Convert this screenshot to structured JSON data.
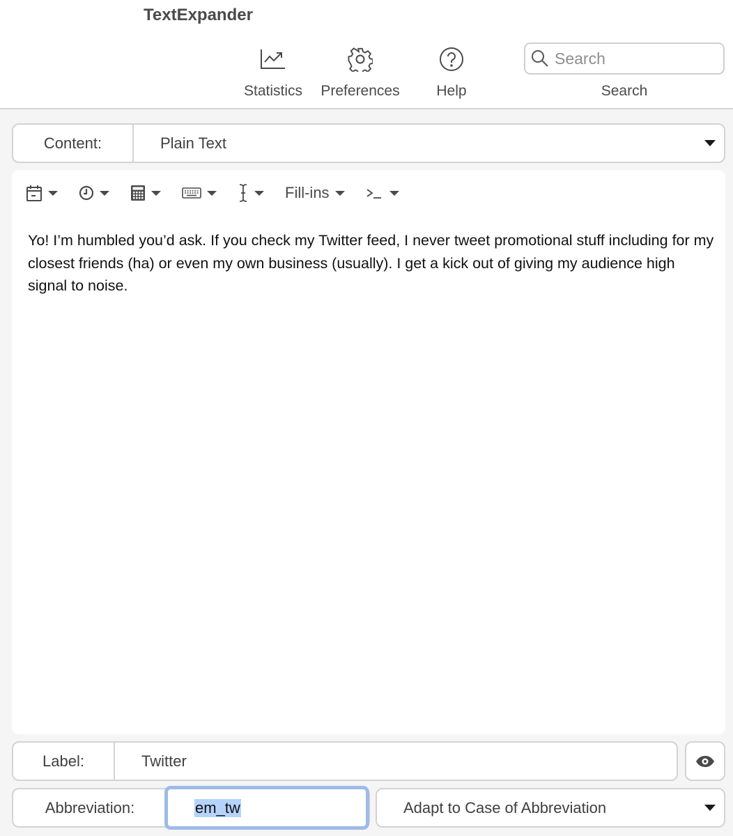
{
  "window": {
    "title": "TextExpander"
  },
  "toolbar": {
    "items": [
      {
        "label": "Statistics",
        "icon": "statistics-chart-icon"
      },
      {
        "label": "Preferences",
        "icon": "gear-icon"
      },
      {
        "label": "Help",
        "icon": "help-question-icon"
      }
    ],
    "search": {
      "placeholder": "Search",
      "value": "",
      "caption": "Search",
      "icon": "search-icon"
    }
  },
  "content_type": {
    "label": "Content:",
    "selected": "Plain Text"
  },
  "editor_toolbar": {
    "items": [
      {
        "icon": "calendar-icon",
        "has_menu": true
      },
      {
        "icon": "clock-icon",
        "has_menu": true
      },
      {
        "icon": "calculator-icon",
        "has_menu": true
      },
      {
        "icon": "keyboard-icon",
        "has_menu": true
      },
      {
        "icon": "text-cursor-icon",
        "has_menu": true
      },
      {
        "label": "Fill-ins",
        "has_menu": true
      },
      {
        "icon": "terminal-prompt-icon",
        "has_menu": true
      }
    ]
  },
  "snippet": {
    "content": "Yo! I’m humbled you’d ask. If you check my Twitter feed, I never tweet promotional stuff including for my closest friends (ha) or even my own business (usually). I get a kick out of giving my audience high signal to noise."
  },
  "label_field": {
    "label": "Label:",
    "value": "Twitter",
    "preview_icon": "eye-icon"
  },
  "abbreviation_field": {
    "label": "Abbreviation:",
    "value": "em_tw",
    "selected": true
  },
  "case_option": {
    "selected": "Adapt to Case of Abbreviation"
  },
  "colors": {
    "focus_ring": "#9dbbe8",
    "selection": "#b5d3fb",
    "window_bg": "#f5f5f5"
  }
}
